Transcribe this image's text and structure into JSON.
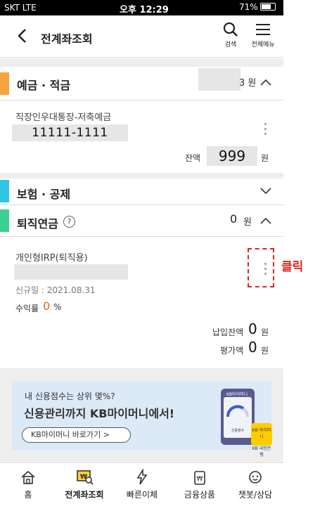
{
  "status_bar": {
    "signal": "SKT  LTE",
    "time": "오후 12:29",
    "battery": "71%"
  },
  "header": {
    "title": "전계좌조회",
    "search_label": "검색",
    "menu_label": "전체메뉴"
  },
  "deposit": {
    "title": "예금 · 적금",
    "amount_visible": "3 원",
    "color": "#f7a33e",
    "account_name": "직장인우대통장-저축예금",
    "account_number": "11111-1111",
    "balance_label": "잔액",
    "balance_value": "999",
    "balance_unit": "원"
  },
  "insurance": {
    "title": "보험 · 공제",
    "color": "#2fc5e6"
  },
  "pension": {
    "title": "퇴직연금",
    "help": "?",
    "amount": "0",
    "unit": "원",
    "color": "#3bd08f",
    "account_name": "개인형IRP(퇴직용)",
    "new_date": "신규일 : 2021.08.31",
    "yield_label": "수익률",
    "yield_value": "0",
    "yield_unit": "%",
    "paid_label": "납입잔액",
    "paid_value": "0",
    "paid_unit": "원",
    "eval_label": "평가액",
    "eval_value": "0",
    "eval_unit": "원"
  },
  "annotation": {
    "click": "클릭",
    "color": "#e0241b"
  },
  "banner": {
    "line1": "내 신용점수는 상위 몇%?",
    "line2": "신용관리까지 KB마이머니에서!",
    "button": "KB마이머니 바로가기  >",
    "phone_label": "KB마이머니",
    "score_label": "신용점수",
    "card_label": "KB 마이머니",
    "card_sub": "KB 국민은행"
  },
  "tabs": [
    {
      "label": "홈",
      "icon": "home-icon"
    },
    {
      "label": "전계좌조회",
      "icon": "account-search-icon"
    },
    {
      "label": "빠른이체",
      "icon": "lightning-icon"
    },
    {
      "label": "금융상품",
      "icon": "product-icon"
    },
    {
      "label": "챗봇/상담",
      "icon": "chatbot-icon"
    }
  ]
}
